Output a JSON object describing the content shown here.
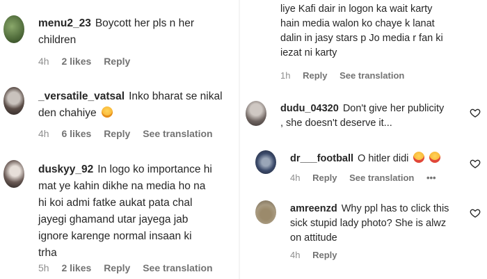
{
  "left_comments": [
    {
      "username": "menu2_23",
      "lines": [
        "Boycott her pls n her",
        "children"
      ],
      "time": "4h",
      "likes": "2 likes",
      "reply": "Reply",
      "translate": ""
    },
    {
      "username": "_versatile_vatsal",
      "lines": [
        "Inko bharat se nikal",
        "den chahiye"
      ],
      "time": "4h",
      "likes": "6 likes",
      "reply": "Reply",
      "translate": "See translation"
    },
    {
      "username": "duskyy_92",
      "lines": [
        "In logo ko importance hi",
        "mat ye kahin dikhe na media ho na",
        "hi koi admi fatke aukat pata chal",
        "jayegi ghamand utar jayega jab",
        "ignore karenge normal insaan ki",
        "trha"
      ],
      "time": "5h",
      "likes": "2 likes",
      "reply": "Reply",
      "translate": "See translation"
    }
  ],
  "right_partial": {
    "lines": [
      "liye Kafi dair in logon ka wait karty",
      "hain media walon ko chaye k lanat",
      "dalin in jasy stars p Jo media r fan ki",
      "iezat ni karty"
    ],
    "time": "1h",
    "reply": "Reply",
    "translate": "See translation"
  },
  "right_comments": [
    {
      "username": "dudu_04320",
      "lines": [
        "Don't give her publicity",
        ", she doesn't deserve it..."
      ],
      "time": "",
      "reply": "",
      "translate": ""
    },
    {
      "username": "dr___football",
      "lines": [
        "O hitler didi"
      ],
      "time": "4h",
      "reply": "Reply",
      "translate": "See translation",
      "more": "•••"
    },
    {
      "username": "amreenzd",
      "lines": [
        "Why ppl has to click this",
        "sick stupid lady photo? She is alwz",
        "on attitude"
      ],
      "time": "4h",
      "reply": "Reply",
      "translate": ""
    }
  ],
  "colors": {
    "text": "#262626",
    "meta": "#8e8e8e",
    "emoji": "#f5b83a"
  },
  "icons": [
    "heart-icon",
    "grinning-emoji-icon"
  ]
}
